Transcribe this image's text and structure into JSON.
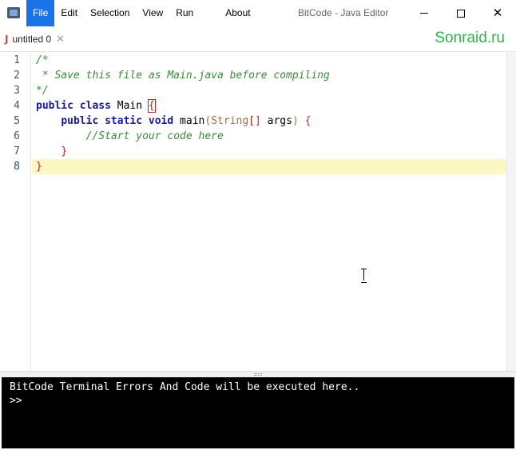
{
  "window": {
    "title": "BitCode - Java Editor",
    "controls": {
      "minimize": "",
      "maximize": "",
      "close": "✕"
    }
  },
  "menu": {
    "items": [
      "File",
      "Edit",
      "Selection",
      "View",
      "Run",
      "About"
    ],
    "active": "File"
  },
  "tabs": [
    {
      "icon": "J",
      "label": "untitled 0",
      "close": "✕"
    }
  ],
  "brand": "Sonraid.ru",
  "editor": {
    "line_numbers": [
      "1",
      "2",
      "3",
      "4",
      "5",
      "6",
      "7",
      "8"
    ],
    "current_line": "8",
    "lines": {
      "l1": "/*",
      "l2": " * Save this file as Main.java before compiling",
      "l3": "*/",
      "l4_kw1": "public",
      "l4_kw2": "class",
      "l4_name": "Main",
      "l4_brace": "{",
      "l5_kw1": "public",
      "l5_kw2": "static",
      "l5_kw3": "void",
      "l5_name": "main",
      "l5_paren_open": "(",
      "l5_type": "String",
      "l5_brackets": "[]",
      "l5_arg": "args",
      "l5_paren_close": ")",
      "l5_brace": "{",
      "l6": "//Start your code here",
      "l7": "}",
      "l8": "}"
    }
  },
  "terminal": {
    "lines": [
      "BitCode Terminal Errors And Code will be executed here..",
      ">>"
    ]
  },
  "colors": {
    "menu_active": "#1a73e8",
    "brand": "#2fb24a",
    "active_line": "#fdf7c3",
    "keyword": "#1a1a9a",
    "comment": "#3a8a3a",
    "bracket": "#c62020",
    "terminal_bg": "#000000"
  }
}
